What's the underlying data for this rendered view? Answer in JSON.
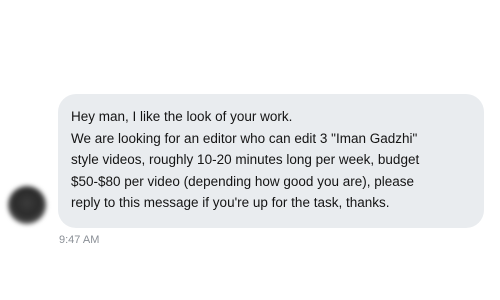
{
  "message": {
    "lines": [
      "Hey man, I like the look of your work.",
      "We are looking for an editor who can edit 3 \"Iman Gadzhi\"",
      "style videos, roughly 10-20 minutes long per week, budget",
      "$50-$80 per video (depending how good you are), please",
      "reply to this message if you're up for the task, thanks."
    ],
    "timestamp": "9:47 AM"
  },
  "colors": {
    "bubble_background": "#e9ecef",
    "text": "#141414",
    "timestamp": "#8a8f96"
  }
}
